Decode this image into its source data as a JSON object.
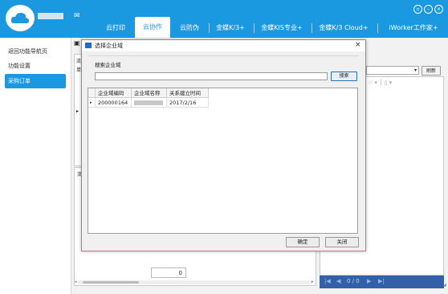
{
  "topbar": {
    "nav_items": [
      "云打印",
      "云协作",
      "云防伪",
      "金蝶K/3+",
      "金蝶KIS专业+",
      "金蝶K/3 Cloud+",
      "iWorker工作家+"
    ],
    "active_index": 1,
    "accent": "#1a98e0"
  },
  "sidebar": {
    "items": [
      {
        "label": "返回功能导航页"
      },
      {
        "label": "功能设置"
      },
      {
        "label": "采购订单"
      }
    ],
    "active_index": 2
  },
  "main": {
    "refresh_label": "刷新",
    "bottom_value": "0",
    "pager_text": "0 / 0",
    "bg_header_char": "单",
    "bg_tab_char": "流",
    "bg_tab_char2": "流"
  },
  "dialog": {
    "title": "选择企业域",
    "search_label": "搜索企业域",
    "search_placeholder": "",
    "search_button": "搜索",
    "columns": [
      "企业域编码",
      "企业域名称",
      "关系建立时间"
    ],
    "rows": [
      {
        "code": "200000164",
        "name": "",
        "date": "2017/2/16"
      }
    ],
    "ok_button": "确定",
    "close_button": "关闭"
  }
}
